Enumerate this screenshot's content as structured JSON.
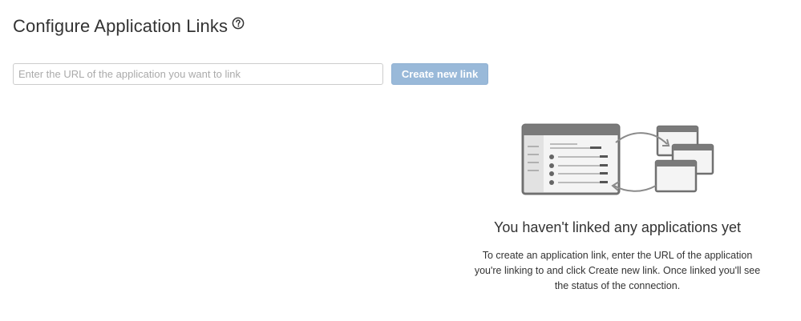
{
  "header": {
    "title": "Configure Application Links",
    "help_icon": "question-circle-icon"
  },
  "link_form": {
    "url_placeholder": "Enter the URL of the application you want to link",
    "url_value": "",
    "create_button_label": "Create new link",
    "create_button_color": "#99b9d9"
  },
  "empty_state": {
    "illustration": "linked-applications-illustration",
    "heading": "You haven't linked any applications yet",
    "description": "To create an application link, enter the URL of the application you're linking to and click Create new link. Once linked you'll see the status of the connection."
  }
}
